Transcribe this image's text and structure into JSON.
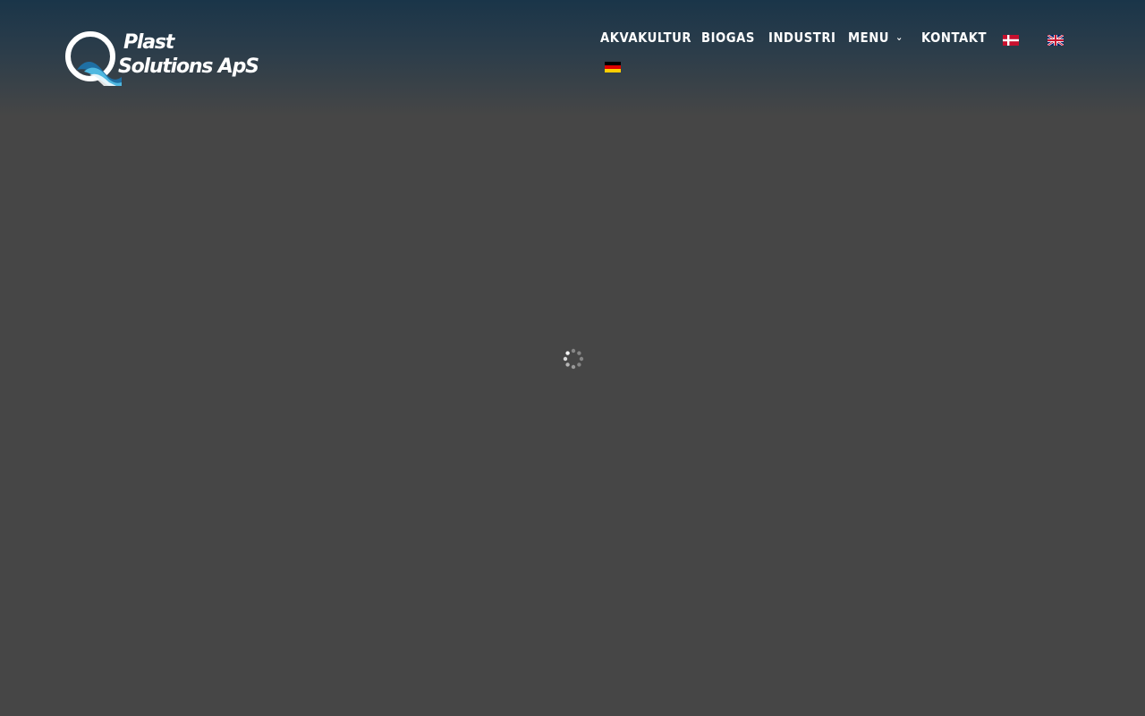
{
  "brand": {
    "line1": "Plast",
    "line2": "Solutions ApS"
  },
  "nav": {
    "items": [
      {
        "label": "AKVAKULTUR"
      },
      {
        "label": "BIOGAS"
      },
      {
        "label": "INDUSTRI"
      },
      {
        "label": "MENU",
        "has_dropdown": true
      },
      {
        "label": "KONTAKT"
      }
    ],
    "languages": [
      {
        "code": "da",
        "icon": "danish-flag-icon"
      },
      {
        "code": "en",
        "icon": "uk-flag-icon"
      },
      {
        "code": "de",
        "icon": "german-flag-icon"
      }
    ]
  },
  "colors": {
    "background": "#464646",
    "header_top": "#1a3549",
    "text": "#ffffff",
    "logo_wave_dark": "#1f6fa3",
    "logo_wave_light": "#4fb8e0"
  },
  "status": {
    "loading_icon": "loading-spinner-icon"
  }
}
